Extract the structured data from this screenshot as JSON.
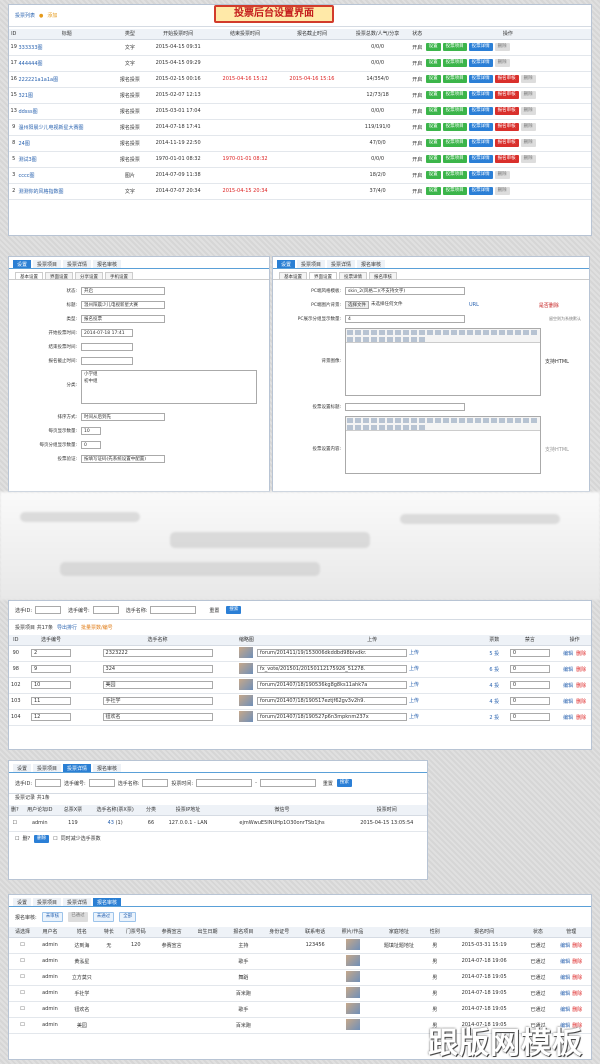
{
  "banner": "投票后台设置界面",
  "list": {
    "head": "投票列表",
    "add": "添加",
    "cols": [
      "ID",
      "标题",
      "类型",
      "开始投票时间",
      "结束投票时间",
      "报名截止时间",
      "投票总数/人气/分享",
      "状态",
      "操作"
    ],
    "rows": [
      {
        "id": "19",
        "title": "333333图",
        "type": "文字",
        "start": "2015-04-15 09:31",
        "end": "",
        "sign": "",
        "total": "0/0/0",
        "status": "开启",
        "btns": [
          "设置",
          "投票项目",
          "投票详情",
          "删除"
        ]
      },
      {
        "id": "17",
        "title": "444444图",
        "type": "文字",
        "start": "2015-04-15 09:29",
        "end": "",
        "sign": "",
        "total": "0/0/0",
        "status": "开启",
        "btns": [
          "设置",
          "投票项目",
          "投票详情",
          "删除"
        ]
      },
      {
        "id": "16",
        "title": "222221a1a1a图",
        "type": "报名投票",
        "start": "2015-02-15 00:16",
        "end": "2015-04-16 15:12",
        "sign": "2015-04-16 15:16",
        "total": "14/354/0",
        "status": "开启",
        "btns": [
          "设置",
          "投票项目",
          "投票详情",
          "报名审核",
          "删除"
        ]
      },
      {
        "id": "15",
        "title": "321图",
        "type": "报名投票",
        "start": "2015-02-07 12:13",
        "end": "",
        "sign": "",
        "total": "12/73/18",
        "status": "开启",
        "btns": [
          "设置",
          "投票项目",
          "投票详情",
          "报名审核",
          "删除"
        ]
      },
      {
        "id": "13",
        "title": "ddsss图",
        "type": "报名投票",
        "start": "2015-03-01 17:04",
        "end": "",
        "sign": "",
        "total": "0/0/0",
        "status": "开启",
        "btns": [
          "设置",
          "投票项目",
          "投票详情",
          "报名审核",
          "删除"
        ]
      },
      {
        "id": "9",
        "title": "温州阳晨少儿电视新星大赛图",
        "type": "报名投票",
        "start": "2014-07-18 17:41",
        "end": "",
        "sign": "",
        "total": "119/191/0",
        "status": "开启",
        "btns": [
          "设置",
          "投票项目",
          "投票详情",
          "报名审核",
          "删除"
        ]
      },
      {
        "id": "8",
        "title": "24图",
        "type": "报名投票",
        "start": "2014-11-19 22:50",
        "end": "",
        "sign": "",
        "total": "47/0/0",
        "status": "开启",
        "btns": [
          "设置",
          "投票项目",
          "投票详情",
          "报名审核",
          "删除"
        ]
      },
      {
        "id": "5",
        "title": "测试3图",
        "type": "报名投票",
        "start": "1970-01-01 08:32",
        "end": "1970-01-01 08:32",
        "sign": "",
        "total": "0/0/0",
        "status": "开启",
        "btns": [
          "设置",
          "投票项目",
          "投票详情",
          "报名审核",
          "删除"
        ]
      },
      {
        "id": "3",
        "title": "cccc图",
        "type": "图片",
        "start": "2014-07-09 11:38",
        "end": "",
        "sign": "",
        "total": "18/2/0",
        "status": "开启",
        "btns": [
          "设置",
          "投票项目",
          "投票详情",
          "删除"
        ]
      },
      {
        "id": "2",
        "title": "测测你的风格指数图",
        "type": "文字",
        "start": "2014-07-07 20:34",
        "end": "2015-04-15 20:34",
        "sign": "",
        "total": "37/4/0",
        "status": "开启",
        "btns": [
          "设置",
          "投票项目",
          "投票详情",
          "删除"
        ]
      }
    ]
  },
  "tabs": [
    "设置",
    "投票项目",
    "投票详情",
    "报名审核"
  ],
  "settings": {
    "subtabs": [
      "基本设置",
      "界面设置",
      "分享设置",
      "手机设置"
    ],
    "fields": [
      {
        "label": "状态:",
        "value": "开启"
      },
      {
        "label": "标题:",
        "value": "温州阳晨少儿电视新星大赛"
      },
      {
        "label": "类型:",
        "value": "报名投票"
      },
      {
        "label": "开始投票时间:",
        "value": "2014-07-18 17:41"
      },
      {
        "label": "结束投票时间:",
        "value": ""
      },
      {
        "label": "报名截止时间:",
        "value": ""
      }
    ],
    "cat_label": "分类:",
    "cat_lines": [
      "小学组",
      "初中组"
    ],
    "more": [
      {
        "label": "排序方式:",
        "value": "时间从后到先"
      },
      {
        "label": "每页显示数量:",
        "value": "10"
      },
      {
        "label": "每页分组显示数量:",
        "value": "0"
      },
      {
        "label": "投票验证:",
        "value": "按填写证码(先系统设置中配置)"
      }
    ]
  },
  "ui": {
    "subtabs": [
      "基本设置",
      "界面设置",
      "投票详情",
      "报名审核"
    ],
    "tpl_label": "PC端风格模板:",
    "tpl_value": "skin_2(风格二)(不支持文字)",
    "banner_label": "PC端图片背景:",
    "choose": "选择文件",
    "nofile": "未选择任何文件",
    "url": "URL",
    "delete": "是否删除",
    "group_label": "PC展示分组显示数量:",
    "group_value": "4",
    "hint": "留空则为系统默认",
    "bg_label": "背景图像:",
    "html": "支持HTML",
    "vote_label": "投票设置标题:",
    "content_label": "投票设置内容:",
    "html2": "支持HTML"
  },
  "items": {
    "search": {
      "id": "选手ID:",
      "no": "选手编号:",
      "name": "选手名称:",
      "reset": "重置",
      "btn": "搜索"
    },
    "summary": "投票项目 共17条",
    "export": "导出排行",
    "batch": "批量票数/编号",
    "cols": [
      "ID",
      "选手编号",
      "选手名称",
      "缩略图",
      "上传",
      "票数",
      "禁言",
      "操作"
    ],
    "rows": [
      {
        "id": "90",
        "no": "2",
        "name": "2323222",
        "img": "forum/201411/19/153006dkddbd98bivdkr.",
        "votes": "5 投",
        "ban": "0"
      },
      {
        "id": "98",
        "no": "9",
        "name": "324",
        "img": "fx_vote/201501/20150112175926_51278.",
        "votes": "6 投",
        "ban": "0"
      },
      {
        "id": "102",
        "no": "10",
        "name": "美园",
        "img": "forum/201407/18/190536kg8g8ks11ahk7a",
        "votes": "4 投",
        "ban": "0"
      },
      {
        "id": "103",
        "no": "11",
        "name": "手社学",
        "img": "forum/201407/18/190517eztjf62gv3v2h9.",
        "votes": "4 投",
        "ban": "0"
      },
      {
        "id": "104",
        "no": "12",
        "name": "钮欢名",
        "img": "forum/201407/18/190527p6n3mpknm237x",
        "votes": "2 投",
        "ban": "0"
      }
    ],
    "upload": "上传",
    "edit": "编辑",
    "del": "删除"
  },
  "detail": {
    "search": {
      "id": "选手ID:",
      "no": "选手编号:",
      "name": "选手名称:",
      "time": "投票时间:",
      "dash": "-",
      "reset": "重置",
      "btn": "搜索"
    },
    "summary": "投票记录 共1条",
    "cols": [
      "删?",
      "用户论坛ID",
      "总票X票",
      "选手名称(票X票)",
      "分类",
      "投票IP地址",
      "微信号",
      "投票时间"
    ],
    "row": {
      "uid": "admin",
      "total": "119",
      "name": "43",
      "count": "(1)",
      "cat": "66",
      "ip": "127.0.0.1 - LAN",
      "wx": "ejmWwuE5INUHp1O30onrTSb1jhs",
      "time": "2015-04-15 13:05:54"
    },
    "del_label": "删?",
    "del_btn": "删除",
    "opt": "同时减少选手票数"
  },
  "review": {
    "filter": "报名审核:",
    "chips": [
      "未审核",
      "已通过",
      "未通过",
      "全部"
    ],
    "cols": [
      "请选择",
      "用户名",
      "姓名",
      "特长",
      "门票号码",
      "参赛宣言",
      "出生日期",
      "报名项目",
      "身份证号",
      "联系电话",
      "照片/作品",
      "家庭地址",
      "性别",
      "报名时间",
      "状态",
      "管理"
    ],
    "rows": [
      {
        "user": "admin",
        "name": "达到海",
        "skill": "无",
        "ticket": "120",
        "decl": "参赛宣言",
        "proj": "主持",
        "phone": "123456",
        "addr": "题填址题地址",
        "sex": "男",
        "time": "2015-03-31 15:19",
        "state": "已通过"
      },
      {
        "user": "admin",
        "name": "黄泓星",
        "skill": "",
        "ticket": "",
        "decl": "",
        "proj": "歌手",
        "phone": "",
        "addr": "",
        "sex": "男",
        "time": "2014-07-18 19:06",
        "state": "已通过"
      },
      {
        "user": "admin",
        "name": "立方莫只",
        "skill": "",
        "ticket": "",
        "decl": "",
        "proj": "舞蹈",
        "phone": "",
        "addr": "",
        "sex": "男",
        "time": "2014-07-18 19:05",
        "state": "已通过"
      },
      {
        "user": "admin",
        "name": "手社学",
        "skill": "",
        "ticket": "",
        "decl": "",
        "proj": "百米跑",
        "phone": "",
        "addr": "",
        "sex": "男",
        "time": "2014-07-18 19:05",
        "state": "已通过"
      },
      {
        "user": "admin",
        "name": "钮欢名",
        "skill": "",
        "ticket": "",
        "decl": "",
        "proj": "歌手",
        "phone": "",
        "addr": "",
        "sex": "男",
        "time": "2014-07-18 19:05",
        "state": "已通过"
      },
      {
        "user": "admin",
        "name": "美园",
        "skill": "",
        "ticket": "",
        "decl": "",
        "proj": "百米跑",
        "phone": "",
        "addr": "",
        "sex": "男",
        "time": "2014-07-18 19:05",
        "state": "已通过"
      }
    ],
    "edit": "编辑",
    "del": "删除"
  },
  "watermark": "跟版网模板"
}
